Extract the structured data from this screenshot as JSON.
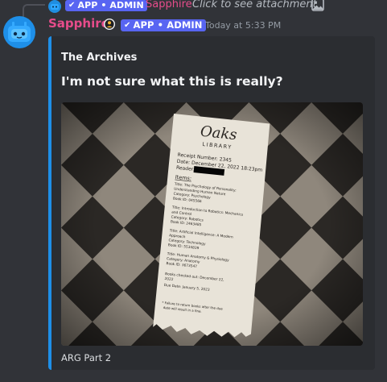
{
  "reply": {
    "tag_label": "APP • ADMIN",
    "author": "Sapphire",
    "text": "Click to see attachment"
  },
  "message": {
    "author": "Sapphire",
    "tag_label": "APP • ADMIN",
    "timestamp": "Today at 5:33 PM",
    "colors": {
      "username": "#e74c8b",
      "tag": "#5865f2",
      "embed_accent": "#1e8fe8"
    }
  },
  "embed": {
    "author": "The Archives",
    "title": "I'm not sure what this is really?",
    "footer": "ARG Part 2",
    "receipt": {
      "logo_top": "Oaks",
      "logo_bottom": "LIBRARY",
      "receipt_number": "Receipt Number: 2345",
      "date": "Date: December 22, 2022   18:23pm",
      "reader": "Reader:",
      "items_heading": "Items:",
      "items": [
        [
          "Title: The Psychology of Personality:",
          "Understanding Human Nature",
          "Category: Psychology",
          "Book ID: 045566"
        ],
        [
          "Title: Introduction to Robotics: Mechanics",
          "and Control",
          "Category: Robotics",
          "Book ID: 2463485"
        ],
        [
          "Title: Artificial Intelligence: A Modern",
          "Approach",
          "Category: Technology",
          "Book ID: 5534839"
        ],
        [
          "Title: Human Anatomy & Physiology",
          "Category: Anatomy",
          "Book ID: 3673547"
        ]
      ],
      "checked_out": [
        "Books checked out: December 22,",
        "2022"
      ],
      "due_date": "Due Date:  January 5, 2023",
      "note": [
        "* Failure to return books after the due",
        "date will result in a fine."
      ]
    }
  }
}
